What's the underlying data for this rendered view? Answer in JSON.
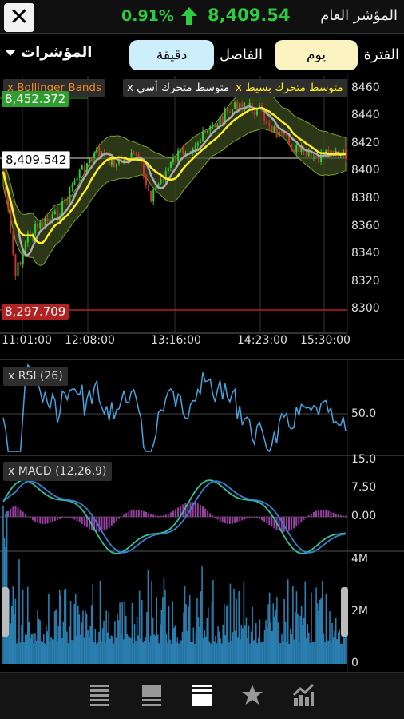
{
  "header": {
    "change_pct": "0.91%",
    "value": "8,409.54",
    "title": "المؤشر العام",
    "trend": "up",
    "up_color": "#2ecc40"
  },
  "toolbar": {
    "indicators_label": "المؤشرات",
    "interval_value": "دقيقة",
    "interval_label": "الفاصل",
    "period_value": "يوم",
    "period_label": "الفترة"
  },
  "price_chart": {
    "indicator_tags": [
      {
        "label": "x  Bollinger Bands",
        "color": "#f08a24"
      },
      {
        "label": "x  متوسط متحرك أسي",
        "color": "#ffffff"
      },
      {
        "label": "x  متوسط متحرك بسيط",
        "color": "#ffee22"
      }
    ],
    "high_label": "8,452.372",
    "current_label": "8,409.542",
    "low_label": "8,297.709",
    "y_ticks": [
      "8460",
      "8440",
      "8420",
      "8400",
      "8380",
      "8360",
      "8340",
      "8320",
      "8300"
    ],
    "x_ticks": [
      "11:01:00",
      "12:08:00",
      "13:16:00",
      "14:23:00",
      "15:30:00"
    ]
  },
  "rsi_panel": {
    "label": "x  RSI (26)",
    "y_tick": "50.0"
  },
  "macd_panel": {
    "label": "x  MACD (12,26,9)",
    "y_ticks": [
      "15.0",
      "7.50",
      "0.00"
    ]
  },
  "volume_panel": {
    "y_ticks": [
      "4M",
      "2M",
      "0"
    ]
  },
  "bottom_nav": {
    "items": [
      "list-icon",
      "detail-icon",
      "chart-icon",
      "star-icon",
      "trend-icon"
    ],
    "active": "chart-icon"
  }
}
